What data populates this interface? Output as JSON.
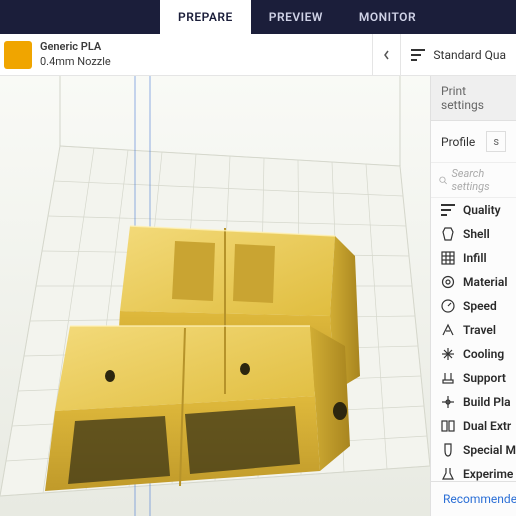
{
  "nav": {
    "prepare": "PREPARE",
    "preview": "PREVIEW",
    "monitor": "MONITOR"
  },
  "material": {
    "name": "Generic PLA",
    "nozzle": "0.4mm Nozzle"
  },
  "quality": {
    "label": "Standard Qua"
  },
  "panel": {
    "title": "Print settings",
    "profile_label": "Profile",
    "profile_value": "s",
    "search_placeholder": "Search settings"
  },
  "categories": [
    {
      "icon": "quality",
      "label": "Quality"
    },
    {
      "icon": "shell",
      "label": "Shell"
    },
    {
      "icon": "infill",
      "label": "Infill"
    },
    {
      "icon": "material",
      "label": "Material"
    },
    {
      "icon": "speed",
      "label": "Speed"
    },
    {
      "icon": "travel",
      "label": "Travel"
    },
    {
      "icon": "cooling",
      "label": "Cooling"
    },
    {
      "icon": "support",
      "label": "Support"
    },
    {
      "icon": "buildplate",
      "label": "Build Pla"
    },
    {
      "icon": "dual",
      "label": "Dual Extr"
    },
    {
      "icon": "special",
      "label": "Special M"
    },
    {
      "icon": "experimental",
      "label": "Experime"
    }
  ],
  "recommended": "Recommende",
  "model": {
    "name": "yellow-3d-part",
    "color": "#e8c84e"
  }
}
